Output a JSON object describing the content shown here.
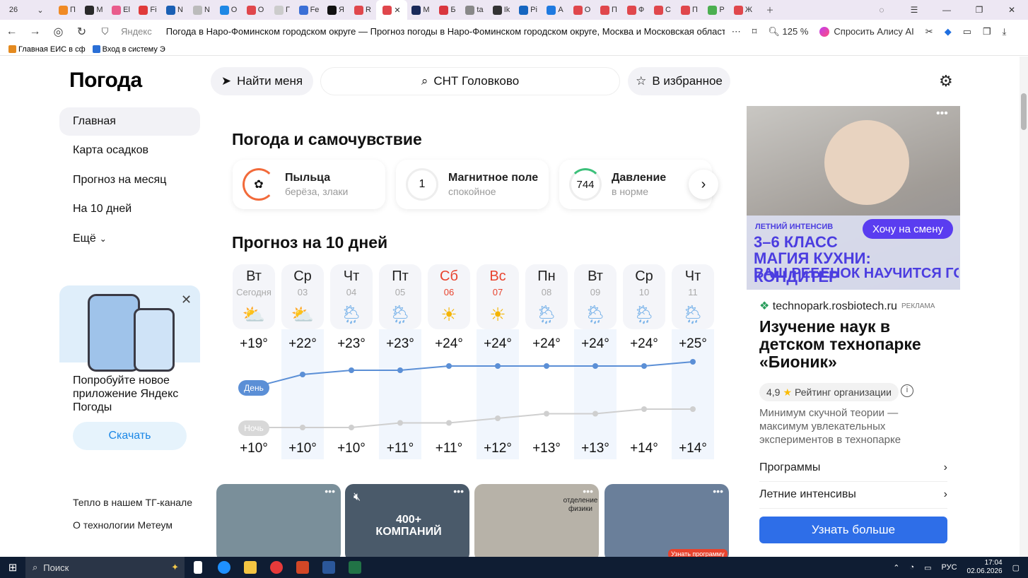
{
  "browser": {
    "tab_count": "26",
    "tabs": [
      {
        "label": "П",
        "color": "#f08a24"
      },
      {
        "label": "М",
        "color": "#2a2a2a"
      },
      {
        "label": "El",
        "color": "#e95c8c"
      },
      {
        "label": "Fi",
        "color": "#e03a3a"
      },
      {
        "label": "N",
        "color": "#1a5fb4"
      },
      {
        "label": "N",
        "color": "#bbbbbb"
      },
      {
        "label": "О",
        "color": "#1e88e5"
      },
      {
        "label": "О",
        "color": "#e0474c"
      },
      {
        "label": "Г",
        "color": "#cccccc"
      },
      {
        "label": "Fe",
        "color": "#3b6fd6"
      },
      {
        "label": "Я",
        "color": "#111111"
      },
      {
        "label": "R",
        "color": "#e0474c"
      },
      {
        "label": "",
        "color": "#e0474c",
        "active": true
      },
      {
        "label": "М",
        "color": "#1a2a5a"
      },
      {
        "label": "Б",
        "color": "#d9363e"
      },
      {
        "label": "ta",
        "color": "#888888"
      },
      {
        "label": "Ik",
        "color": "#333333"
      },
      {
        "label": "Pi",
        "color": "#1565c0"
      },
      {
        "label": "А",
        "color": "#1f7ae0"
      },
      {
        "label": "О",
        "color": "#e0474c"
      },
      {
        "label": "П",
        "color": "#e0474c"
      },
      {
        "label": "Ф",
        "color": "#e0474c"
      },
      {
        "label": "С",
        "color": "#e0474c"
      },
      {
        "label": "П",
        "color": "#e0474c"
      },
      {
        "label": "Р",
        "color": "#4caf50"
      },
      {
        "label": "Ж",
        "color": "#e0474c"
      }
    ],
    "url_host": "Яндекс",
    "page_title": "Погода в Наро-Фоминском городском округе — Прогноз погоды в Наро-Фоминском городском округе, Москва и Московская область, Россия",
    "zoom": "125 %",
    "alice": "Спросить Алису AI",
    "bookmarks": [
      "Главная ЕИС в сф",
      "Вход в систему Э"
    ]
  },
  "weather": {
    "logo": "Погода",
    "find_me": "Найти меня",
    "search_value": "СНТ Головково",
    "favorites": "В избранное",
    "sidebar": [
      "Главная",
      "Карта осадков",
      "Прогноз на месяц",
      "На 10 дней",
      "Ещё"
    ],
    "promo": {
      "text": "Попробуйте новое приложение Яндекс Погоды",
      "button": "Скачать"
    },
    "footer_links": [
      "Тепло в нашем ТГ-канале",
      "О технологии Метеум"
    ],
    "wellbeing_title": "Погода и самочувствие",
    "wellbeing": [
      {
        "name": "Пыльца",
        "sub": "берёза, злаки",
        "icon": "pollen-icon",
        "value": ""
      },
      {
        "name": "Магнитное поле",
        "sub": "спокойное",
        "icon": "magnetic-gauge-icon",
        "value": "1"
      },
      {
        "name": "Давление",
        "sub": "в норме",
        "icon": "pressure-gauge-icon",
        "value": "744"
      }
    ],
    "forecast_title": "Прогноз на 10 дней",
    "label_day": "День",
    "label_night": "Ночь",
    "days": [
      {
        "name": "Вт",
        "date": "Сегодня",
        "icon": "partly-cloudy-icon",
        "day": "+19°",
        "night": "+10°",
        "weekend": false
      },
      {
        "name": "Ср",
        "date": "03",
        "icon": "partly-cloudy-icon",
        "day": "+22°",
        "night": "+10°",
        "weekend": false
      },
      {
        "name": "Чт",
        "date": "04",
        "icon": "rain-sun-icon",
        "day": "+23°",
        "night": "+10°",
        "weekend": false
      },
      {
        "name": "Пт",
        "date": "05",
        "icon": "rain-sun-icon",
        "day": "+23°",
        "night": "+11°",
        "weekend": false
      },
      {
        "name": "Сб",
        "date": "06",
        "icon": "sun-icon",
        "day": "+24°",
        "night": "+11°",
        "weekend": true
      },
      {
        "name": "Вс",
        "date": "07",
        "icon": "sun-icon",
        "day": "+24°",
        "night": "+12°",
        "weekend": true
      },
      {
        "name": "Пн",
        "date": "08",
        "icon": "rain-sun-icon",
        "day": "+24°",
        "night": "+13°",
        "weekend": false
      },
      {
        "name": "Вт",
        "date": "09",
        "icon": "rain-sun-icon",
        "day": "+24°",
        "night": "+13°",
        "weekend": false
      },
      {
        "name": "Ср",
        "date": "10",
        "icon": "rain-sun-icon",
        "day": "+24°",
        "night": "+14°",
        "weekend": false
      },
      {
        "name": "Чт",
        "date": "11",
        "icon": "rain-sun-icon",
        "day": "+25°",
        "night": "+14°",
        "weekend": false
      }
    ],
    "thumbnails": [
      {
        "caption": "",
        "color": "#7a8f9a"
      },
      {
        "caption": "400+ КОМПАНИЙ",
        "color": "#4a5a6a"
      },
      {
        "caption": "отделение физики",
        "color": "#b7b2a8"
      },
      {
        "caption": "Узнать программу",
        "color": "#6a7f9a"
      }
    ]
  },
  "ad": {
    "small": "ЛЕТНИЙ ИНТЕНСИВ",
    "head1": "3–6 КЛАСС",
    "head2": "МАГИЯ КУХНИ: КОНДИТЕР",
    "head3": "ВАШ РЕБЕНОК НАУЧИТСЯ ГОТОВИТЬ ШЕДЕВРЫ!",
    "want": "Хочу на смену",
    "domain": "technopark.rosbiotech.ru",
    "tag": "РЕКЛАМА",
    "title": "Изучение наук в детском технопарке «Бионик»",
    "rating": "4,9",
    "rating_label": "Рейтинг организации",
    "desc": "Минимум скучной теории — максимум увлекательных экспериментов в технопарке",
    "links": [
      "Программы",
      "Летние интенсивы"
    ],
    "cta": "Узнать больше"
  },
  "taskbar": {
    "search": "Поиск",
    "lang": "РУС",
    "time": "17:04",
    "date": "02.06.2026"
  }
}
